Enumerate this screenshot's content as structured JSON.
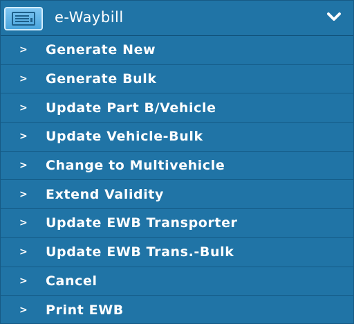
{
  "header": {
    "title": "e-Waybill",
    "icon": "document-list-icon",
    "toggle_icon": "chevron-down-icon"
  },
  "items": [
    {
      "label": "Generate New"
    },
    {
      "label": "Generate Bulk"
    },
    {
      "label": "Update Part B/Vehicle"
    },
    {
      "label": "Update Vehicle-Bulk"
    },
    {
      "label": "Change to Multivehicle"
    },
    {
      "label": "Extend Validity"
    },
    {
      "label": "Update EWB Transporter"
    },
    {
      "label": "Update EWB Trans.-Bulk"
    },
    {
      "label": "Cancel"
    },
    {
      "label": "Print EWB"
    }
  ],
  "item_marker": ">",
  "colors": {
    "background": "#2074a6",
    "text": "#ffffff"
  }
}
